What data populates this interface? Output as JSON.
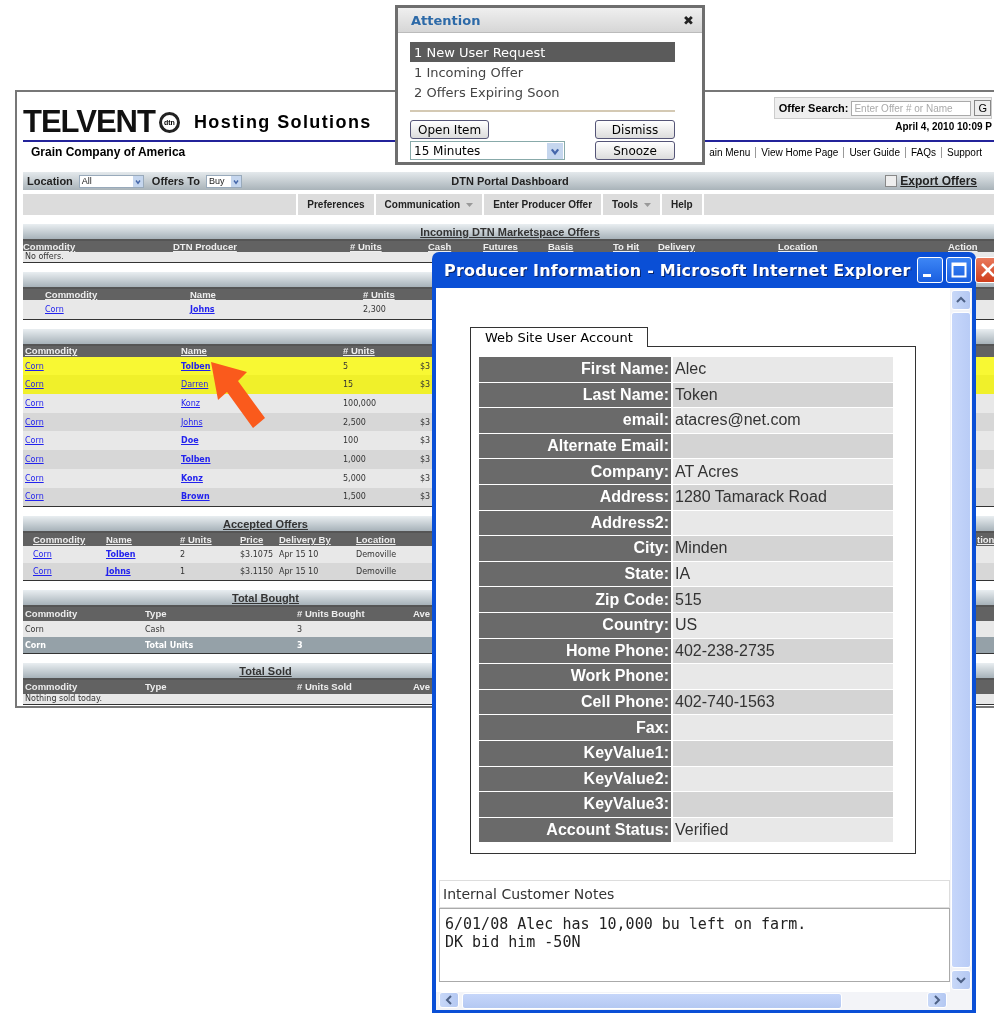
{
  "page": {
    "logo": "TELVENT",
    "logo_badge": "dtn",
    "product": "Hosting Solutions",
    "company": "Grain Company of America",
    "search": {
      "label": "Offer Search:",
      "placeholder": "Enter Offer # or Name",
      "button": "G"
    },
    "datetime": "April 4, 2010 10:09 P",
    "links": [
      "ain Menu",
      "View Home Page",
      "User Guide",
      "FAQs",
      "Support"
    ],
    "filters": [
      {
        "label": "Location",
        "value": "All"
      },
      {
        "label": "Offers To",
        "value": "Buy"
      }
    ],
    "dashboard_title": "DTN Portal Dashboard",
    "export": {
      "label": "Export Offers",
      "checked": false
    },
    "menu": [
      {
        "label": "Preferences",
        "dropdown": false
      },
      {
        "label": "Communication",
        "dropdown": true
      },
      {
        "label": "Enter Producer Offer",
        "dropdown": false
      },
      {
        "label": "Tools",
        "dropdown": true
      },
      {
        "label": "Help",
        "dropdown": false
      }
    ],
    "sections": [
      {
        "title": "Incoming DTN Marketspace Offers",
        "linked_headers": true,
        "columns": [
          "Commodity",
          "DTN Producer",
          "# Units",
          "Cash",
          "Futures",
          "Basis",
          "To Hit",
          "Delivery",
          "Location",
          "Action"
        ],
        "message": "No offers."
      },
      {
        "linked_headers": true,
        "columns": [
          "Commodity",
          "Name",
          "# Units"
        ],
        "rows": [
          {
            "highlighted": false,
            "cells": [
              {
                "text": "Corn",
                "kind": "link"
              },
              {
                "text": "Johns",
                "kind": "bold-link"
              },
              {
                "text": "2,300",
                "kind": "text"
              }
            ]
          }
        ]
      },
      {
        "linked_headers": true,
        "columns": [
          "Commodity",
          "Name",
          "# Units"
        ],
        "rows": [
          {
            "highlighted": true,
            "cells": [
              {
                "text": "Corn",
                "kind": "link"
              },
              {
                "text": "Tolben",
                "kind": "bold-link"
              },
              {
                "text": "5",
                "kind": "text"
              },
              {
                "text": "$3",
                "kind": "text"
              }
            ]
          },
          {
            "highlighted": true,
            "cells": [
              {
                "text": "Corn",
                "kind": "link"
              },
              {
                "text": "Darren",
                "kind": "link"
              },
              {
                "text": "15",
                "kind": "text"
              },
              {
                "text": "$3",
                "kind": "text"
              }
            ]
          },
          {
            "highlighted": false,
            "cells": [
              {
                "text": "Corn",
                "kind": "link"
              },
              {
                "text": "Konz",
                "kind": "link"
              },
              {
                "text": "100,000",
                "kind": "text"
              }
            ]
          },
          {
            "highlighted": false,
            "cells": [
              {
                "text": "Corn",
                "kind": "link"
              },
              {
                "text": "Johns",
                "kind": "link"
              },
              {
                "text": "2,500",
                "kind": "text"
              },
              {
                "text": "$3",
                "kind": "text"
              }
            ]
          },
          {
            "highlighted": false,
            "cells": [
              {
                "text": "Corn",
                "kind": "link"
              },
              {
                "text": "Doe",
                "kind": "bold-link"
              },
              {
                "text": "100",
                "kind": "text"
              },
              {
                "text": "$3",
                "kind": "text"
              }
            ]
          },
          {
            "highlighted": false,
            "cells": [
              {
                "text": "Corn",
                "kind": "link"
              },
              {
                "text": "Tolben",
                "kind": "bold-link"
              },
              {
                "text": "1,000",
                "kind": "text"
              },
              {
                "text": "$3",
                "kind": "text"
              }
            ]
          },
          {
            "highlighted": false,
            "cells": [
              {
                "text": "Corn",
                "kind": "link"
              },
              {
                "text": "Konz",
                "kind": "bold-link"
              },
              {
                "text": "5,000",
                "kind": "text"
              },
              {
                "text": "$3",
                "kind": "text"
              }
            ]
          },
          {
            "highlighted": false,
            "cells": [
              {
                "text": "Corn",
                "kind": "link"
              },
              {
                "text": "Brown",
                "kind": "bold-link"
              },
              {
                "text": "1,500",
                "kind": "text"
              },
              {
                "text": "$3",
                "kind": "text"
              }
            ]
          }
        ]
      },
      {
        "title": "Accepted Offers",
        "linked_headers": true,
        "columns": [
          "Commodity",
          "Name",
          "# Units",
          "Price",
          "Delivery By",
          "Location",
          "tion"
        ],
        "rows": [
          {
            "highlighted": false,
            "cells": [
              {
                "text": "Corn",
                "kind": "link"
              },
              {
                "text": "Tolben",
                "kind": "bold-link"
              },
              {
                "text": "2",
                "kind": "text"
              },
              {
                "text": "$3.1075",
                "kind": "text"
              },
              {
                "text": "Apr 15 10",
                "kind": "text"
              },
              {
                "text": "Demoville",
                "kind": "text"
              }
            ]
          },
          {
            "highlighted": false,
            "cells": [
              {
                "text": "Corn",
                "kind": "link"
              },
              {
                "text": "Johns",
                "kind": "bold-link"
              },
              {
                "text": "1",
                "kind": "text"
              },
              {
                "text": "$3.1150",
                "kind": "text"
              },
              {
                "text": "Apr 15 10",
                "kind": "text"
              },
              {
                "text": "Demoville",
                "kind": "text"
              }
            ]
          }
        ]
      },
      {
        "title": "Total Bought",
        "linked_headers": false,
        "columns": [
          "Commodity",
          "Type",
          "# Units Bought",
          "Ave"
        ],
        "rows": [
          {
            "highlighted": false,
            "cells": [
              {
                "text": "Corn",
                "kind": "text"
              },
              {
                "text": "Cash",
                "kind": "text"
              },
              {
                "text": "3",
                "kind": "text"
              }
            ]
          },
          {
            "highlighted": false,
            "kind": "total",
            "cells": [
              {
                "text": "Corn",
                "kind": "text"
              },
              {
                "text": "Total Units",
                "kind": "text"
              },
              {
                "text": "3",
                "kind": "text"
              }
            ]
          }
        ]
      },
      {
        "title": "Total Sold",
        "linked_headers": false,
        "columns": [
          "Commodity",
          "Type",
          "# Units Sold",
          "Ave"
        ],
        "message": "Nothing sold today."
      }
    ]
  },
  "attention": {
    "title": "Attention",
    "close": "✖",
    "items": [
      {
        "label": "1 New User Request",
        "selected": true
      },
      {
        "label": "1 Incoming Offer",
        "selected": false
      },
      {
        "label": "2 Offers Expiring Soon",
        "selected": false
      }
    ],
    "open_button": "Open Item",
    "snooze_time": "15 Minutes",
    "dismiss_button": "Dismiss",
    "snooze_button": "Snooze"
  },
  "producer_window": {
    "title": "Producer Information - Microsoft Internet Explorer",
    "tab": "Web Site User Account",
    "fields": [
      {
        "label": "First Name:",
        "value": "Alec"
      },
      {
        "label": "Last Name:",
        "value": "Token"
      },
      {
        "label": "email:",
        "value": "atacres@net.com"
      },
      {
        "label": "Alternate Email:"
      },
      {
        "label": "Company:",
        "value": "AT Acres"
      },
      {
        "label": "Address:",
        "value": "1280 Tamarack Road"
      },
      {
        "label": "Address2:"
      },
      {
        "label": "City:",
        "value": "Minden"
      },
      {
        "label": "State:",
        "value": "IA"
      },
      {
        "label": "Zip Code:",
        "value": "515"
      },
      {
        "label": "Country:",
        "value": "US"
      },
      {
        "label": "Home Phone:",
        "value": "402-238-2735"
      },
      {
        "label": "Work Phone:"
      },
      {
        "label": "Cell Phone:",
        "value": "402-740-1563"
      },
      {
        "label": "Fax:"
      },
      {
        "label": "KeyValue1:"
      },
      {
        "label": "KeyValue2:"
      },
      {
        "label": "KeyValue3:"
      },
      {
        "label": "Account Status:",
        "value": "Verified"
      }
    ],
    "notes": {
      "label": "Internal Customer Notes",
      "value": "6/01/08 Alec has 10,000 bu left on farm.\nDK bid him -50N"
    }
  }
}
